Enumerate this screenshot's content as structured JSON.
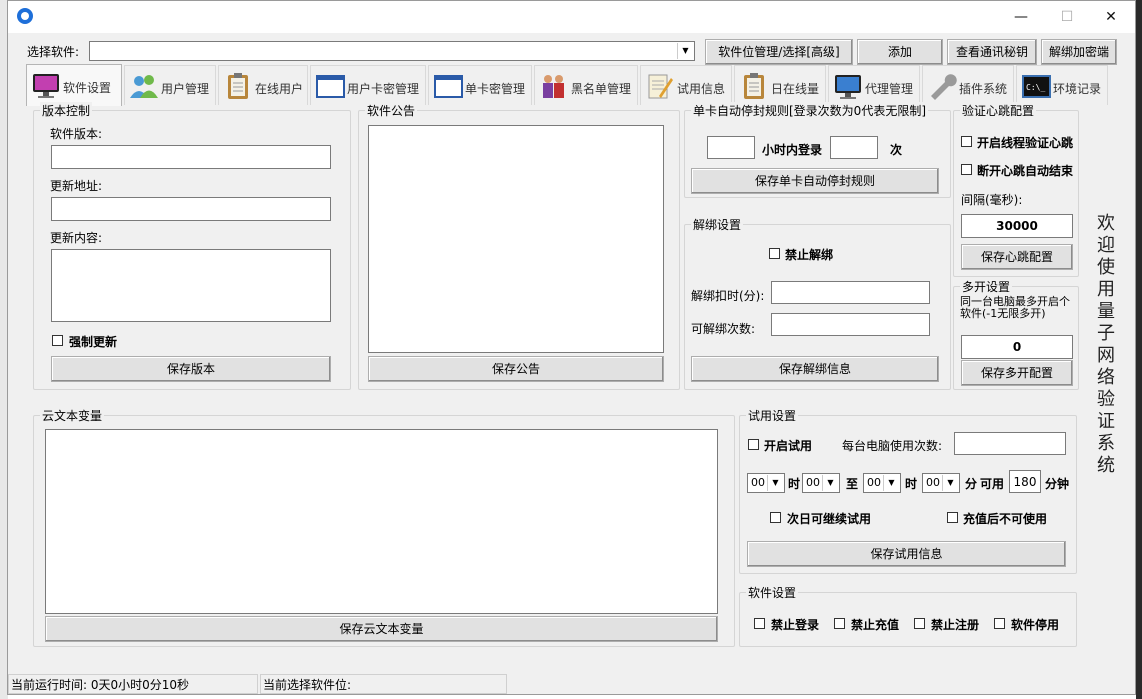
{
  "window": {
    "minimize_glyph": "—",
    "maximize_glyph": "☐",
    "close_glyph": "✕"
  },
  "toolbar": {
    "select_label": "选择软件:",
    "select_value": "",
    "buttons": [
      "软件位管理/选择[高级]",
      "添加",
      "查看通讯秘钥",
      "解绑加密端"
    ]
  },
  "tabs": [
    {
      "label": "软件设置",
      "icon": "monitor-icon"
    },
    {
      "label": "用户管理",
      "icon": "users-icon"
    },
    {
      "label": "在线用户",
      "icon": "clipboard-icon"
    },
    {
      "label": "用户卡密管理",
      "icon": "window-icon"
    },
    {
      "label": "单卡密管理",
      "icon": "window-icon"
    },
    {
      "label": "黑名单管理",
      "icon": "people-icon"
    },
    {
      "label": "试用信息",
      "icon": "notepad-icon"
    },
    {
      "label": "日在线量",
      "icon": "clipboard-icon"
    },
    {
      "label": "代理管理",
      "icon": "monitor-icon"
    },
    {
      "label": "插件系统",
      "icon": "wrench-icon"
    },
    {
      "label": "环境记录",
      "icon": "terminal-icon"
    }
  ],
  "version": {
    "title": "版本控制",
    "software_version_label": "软件版本:",
    "update_url_label": "更新地址:",
    "update_content_label": "更新内容:",
    "force_update_label": "强制更新",
    "save_label": "保存版本"
  },
  "notice": {
    "title": "软件公告",
    "save_label": "保存公告"
  },
  "autoban": {
    "title": "单卡自动停封规则[登录次数为0代表无限制]",
    "hours_label": "小时内登录",
    "times_label": "次",
    "save_label": "保存单卡自动停封规则"
  },
  "unbind": {
    "title": "解绑设置",
    "forbid_label": "禁止解绑",
    "deduct_label": "解绑扣时(分):",
    "count_label": "可解绑次数:",
    "save_label": "保存解绑信息"
  },
  "heartbeat": {
    "title": "验证心跳配置",
    "thread_label": "开启线程验证心跳",
    "disconnect_label": "断开心跳自动结束",
    "interval_label": "间隔(毫秒):",
    "interval_value": "30000",
    "save_label": "保存心跳配置"
  },
  "multi": {
    "title": "多开设置",
    "desc": "同一台电脑最多开启个软件(-1无限多开)",
    "value": "0",
    "save_label": "保存多开配置"
  },
  "welcome": "欢迎使用量子网络验证系统",
  "cloud": {
    "title": "云文本变量",
    "save_label": "保存云文本变量"
  },
  "trial": {
    "title": "试用设置",
    "enable_label": "开启试用",
    "per_pc_label": "每台电脑使用次数:",
    "h1": "00",
    "m1": "00",
    "h2": "00",
    "m2": "00",
    "hour_label": "时",
    "to_label": "至",
    "minute_label": "分",
    "available_label": "可用",
    "minutes_value": "180",
    "minutes_unit": "分钟",
    "next_day_label": "次日可继续试用",
    "no_after_recharge_label": "充值后不可使用",
    "save_label": "保存试用信息"
  },
  "software": {
    "title": "软件设置",
    "options": [
      "禁止登录",
      "禁止充值",
      "禁止注册",
      "软件停用"
    ]
  },
  "status": {
    "runtime": "当前运行时间: 0天0小时0分10秒",
    "selected": "当前选择软件位:"
  }
}
